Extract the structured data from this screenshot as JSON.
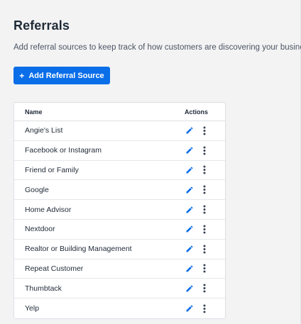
{
  "page": {
    "title": "Referrals",
    "subtitle": "Add referral sources to keep track of how customers are discovering your business."
  },
  "toolbar": {
    "add_label": "Add Referral Source",
    "add_icon": "plus-icon"
  },
  "table": {
    "headers": {
      "name": "Name",
      "actions": "Actions"
    },
    "rows": [
      {
        "label": "Angie's List"
      },
      {
        "label": "Facebook or Instagram"
      },
      {
        "label": "Friend or Family"
      },
      {
        "label": "Google"
      },
      {
        "label": "Home Advisor"
      },
      {
        "label": "Nextdoor"
      },
      {
        "label": "Realtor or Building Management"
      },
      {
        "label": "Repeat Customer"
      },
      {
        "label": "Thumbtack"
      },
      {
        "label": "Yelp"
      }
    ],
    "row_actions": {
      "edit_icon": "pencil-icon",
      "more_icon": "more-vertical-icon"
    }
  },
  "colors": {
    "accent": "#0a6ee8",
    "background": "#f3f3f4",
    "text": "#1f2a37",
    "muted_text": "#4b5563",
    "border": "#dcdfe4"
  }
}
